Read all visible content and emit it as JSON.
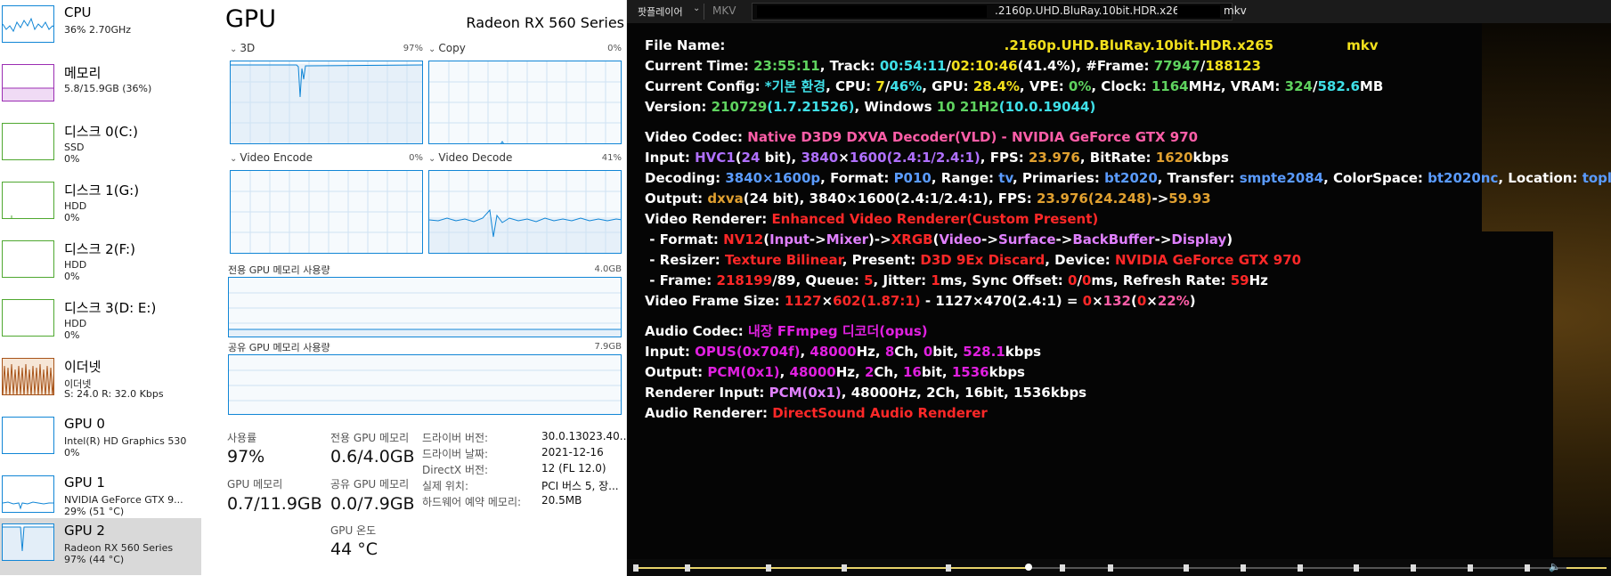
{
  "sidebar": {
    "items": [
      {
        "title": "CPU",
        "sub": "36% 2.70GHz",
        "sub2": ""
      },
      {
        "title": "메모리",
        "sub": "5.8/15.9GB (36%)",
        "sub2": ""
      },
      {
        "title": "디스크 0(C:)",
        "sub": "SSD",
        "sub2": "0%"
      },
      {
        "title": "디스크 1(G:)",
        "sub": "HDD",
        "sub2": "0%"
      },
      {
        "title": "디스크 2(F:)",
        "sub": "HDD",
        "sub2": "0%"
      },
      {
        "title": "디스크 3(D: E:)",
        "sub": "HDD",
        "sub2": "0%"
      },
      {
        "title": "이더넷",
        "sub": "이더넷",
        "sub2": "S: 24.0  R: 32.0 Kbps"
      },
      {
        "title": "GPU 0",
        "sub": "Intel(R) HD Graphics 530",
        "sub2": "0%"
      },
      {
        "title": "GPU 1",
        "sub": "NVIDIA GeForce GTX 9...",
        "sub2": "29% (51 °C)"
      },
      {
        "title": "GPU 2",
        "sub": "Radeon RX 560 Series",
        "sub2": "97% (44 °C)"
      }
    ],
    "selected_index": 9
  },
  "panel": {
    "title": "GPU",
    "device": "Radeon RX 560 Series",
    "engines": [
      {
        "name": "3D",
        "pct": "97%"
      },
      {
        "name": "Copy",
        "pct": "0%"
      },
      {
        "name": "Video Encode",
        "pct": "0%"
      },
      {
        "name": "Video Decode",
        "pct": "41%"
      }
    ],
    "dedicated_mem_label": "전용 GPU 메모리 사용량",
    "dedicated_mem_max": "4.0GB",
    "shared_mem_label": "공유 GPU 메모리 사용량",
    "shared_mem_max": "7.9GB",
    "stats": {
      "usage_label": "사용률",
      "usage_value": "97%",
      "dedicated_label": "전용 GPU 메모리",
      "dedicated_value": "0.6/4.0GB",
      "gpu_mem_label": "GPU 메모리",
      "gpu_mem_value": "0.7/11.9GB",
      "shared_label": "공유 GPU 메모리",
      "shared_value": "0.0/7.9GB",
      "temp_label": "GPU 온도",
      "temp_value": "44 °C"
    },
    "info": [
      {
        "label": "드라이버 버전:",
        "value": "30.0.13023.40..."
      },
      {
        "label": "드라이버 날짜:",
        "value": "2021-12-16"
      },
      {
        "label": "DirectX 버전:",
        "value": "12 (FL 12.0)"
      },
      {
        "label": "실제 위치:",
        "value": "PCI 버스 5, 장..."
      },
      {
        "label": "하드웨어 예약 메모리:",
        "value": "20.5MB"
      }
    ]
  },
  "player": {
    "app_name": "팟플레이어",
    "format": "MKV",
    "file_visible": ".2160p.UHD.BluRay.10bit.HDR.x265",
    "file_ext": "mkv",
    "colors": {
      "accent": "#e8d36a"
    }
  },
  "osd": {
    "file_name_label": "File Name:",
    "file_name_value": ".2160p.UHD.BluRay.10bit.HDR.x265",
    "file_name_ext": "mkv",
    "current_time": "23:55:11",
    "track_pos": "00:54:11",
    "track_total": "02:10:46",
    "track_pct": "(41.4%)",
    "frame_cur": "77947",
    "frame_total": "188123",
    "config_name": "*기본 환경",
    "cpu_cores": "7",
    "cpu_pct": "46%",
    "gpu_pct": "28.4%",
    "vpe_pct": "0%",
    "clock": "1164",
    "vram_used": "324",
    "vram_total": "582.6",
    "version": "210729",
    "version_full": "(1.7.21526)",
    "windows": "10 21H2",
    "windows_build": "(10.0.19044)",
    "video_codec": "Native D3D9 DXVA Decoder(VLD) - NVIDIA GeForce GTX 970",
    "input_fourcc": "HVC1",
    "input_bits": "24",
    "input_w": "3840",
    "input_h": "1600",
    "input_ar": "(2.4:1/2.4:1)",
    "input_fps": "23.976",
    "input_bitrate": "1620",
    "dec_size": "3840×1600p",
    "dec_format": "P010",
    "dec_range": "tv",
    "dec_primaries": "bt2020",
    "dec_transfer": "smpte2084",
    "dec_colorspace": "bt2020nc",
    "dec_location": "topleft",
    "out_format": "dxva",
    "out_bits": "(24 bit)",
    "out_size": "3840×1600(2.4:1/2.4:1)",
    "out_fps": "23.976(24.248)",
    "out_fps_target": "59.93",
    "renderer": "Enhanced Video Renderer(Custom Present)",
    "r_format_in": "NV12",
    "r_format_mid1": "Input",
    "r_format_mid2": "Mixer",
    "r_format_out": "XRGB",
    "r_chain1": "Video",
    "r_chain2": "Surface",
    "r_chain3": "BackBuffer",
    "r_chain4": "Display",
    "resizer": "Texture Bilinear",
    "present": "D3D 9Ex Discard",
    "device": "NVIDIA GeForce GTX 970",
    "frame_a": "218199",
    "frame_b": "89",
    "queue": "5",
    "jitter": "1",
    "sync_a": "0",
    "sync_b": "0",
    "refresh": "59",
    "vfs_w1": "1127",
    "vfs_h1": "602",
    "vfs_ar1": "(1.87:1)",
    "vfs_rest": " - 1127×470(2.4:1) = ",
    "vfs_w2": "0",
    "vfs_h2": "132",
    "vfs_pct_a": "0",
    "vfs_pct_b": "22%",
    "audio_codec": "내장 FFmpeg 디코더(opus)",
    "a_in_codec": "OPUS",
    "a_in_tag": "(0x704f)",
    "a_in_hz": "48000",
    "a_in_ch": "8",
    "a_in_bit": "0",
    "a_in_kbps": "528.1",
    "a_out_codec": "PCM",
    "a_out_tag": "(0x1)",
    "a_out_hz": "48000",
    "a_out_ch": "2",
    "a_out_bit": "16",
    "a_out_kbps": "1536",
    "ri_codec": "PCM",
    "ri_tag": "(0x1)",
    "ri_rest": ", 48000Hz, 2Ch, 16bit, 1536kbps",
    "audio_renderer": "DirectSound Audio Renderer"
  },
  "seek": {
    "progress": 0.414
  }
}
